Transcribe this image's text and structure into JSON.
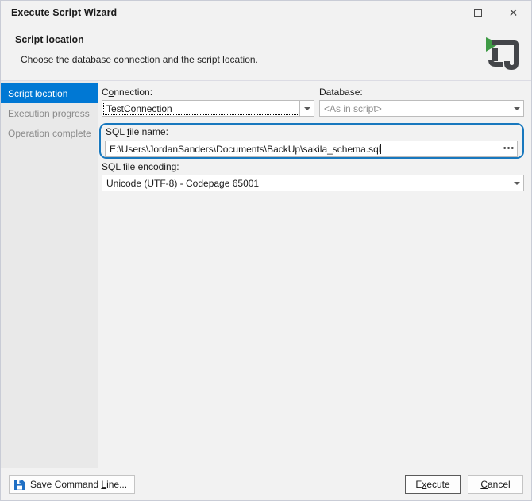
{
  "window": {
    "title": "Execute Script Wizard",
    "caption_buttons": [
      {
        "name": "minimize",
        "label": "–"
      },
      {
        "name": "maximize",
        "label": "□"
      },
      {
        "name": "close",
        "label": "✕"
      }
    ]
  },
  "header": {
    "title": "Script location",
    "subtitle": "Choose the database connection and the script location.",
    "logo_name": "devart-execute-script-logo",
    "logo_colors": {
      "arrow": "#3f9b46",
      "body": "#434549"
    }
  },
  "sidebar": {
    "items": [
      {
        "label": "Script location",
        "state": "active"
      },
      {
        "label": "Execution progress",
        "state": "disabled"
      },
      {
        "label": "Operation complete",
        "state": "disabled"
      }
    ]
  },
  "form": {
    "connection": {
      "label_pre": "C",
      "label_accel": "o",
      "label_post": "nnection:",
      "value": "TestConnection",
      "focused": true
    },
    "database": {
      "label": "Database:",
      "value": "<As in script>",
      "is_placeholder": true
    },
    "sql_file_name": {
      "label_pre": "SQL ",
      "label_accel": "f",
      "label_post": "ile name:",
      "value": "E:\\Users\\JordanSanders\\Documents\\BackUp\\sakila_schema.sql",
      "browse_label": "•••",
      "highlighted": true,
      "highlight_color": "#1878be"
    },
    "sql_file_encoding": {
      "label_pre": "SQL file ",
      "label_accel": "e",
      "label_post": "ncoding:",
      "value": "Unicode (UTF-8) - Codepage 65001"
    }
  },
  "footer": {
    "save_command_line": {
      "label_pre": "Save Command ",
      "label_accel": "L",
      "label_post": "ine...",
      "icon": "floppy-disk-icon",
      "icon_color": "#1f6fc4"
    },
    "execute": {
      "label_pre": "E",
      "label_accel": "x",
      "label_post": "ecute",
      "is_default": true
    },
    "cancel": {
      "label_pre": "",
      "label_accel": "C",
      "label_post": "ancel"
    }
  },
  "colors": {
    "accent": "#0078d4",
    "window_bg": "#f2f2f2",
    "sidebar_bg": "#e9e9e9",
    "highlight_ring": "#1878be"
  }
}
